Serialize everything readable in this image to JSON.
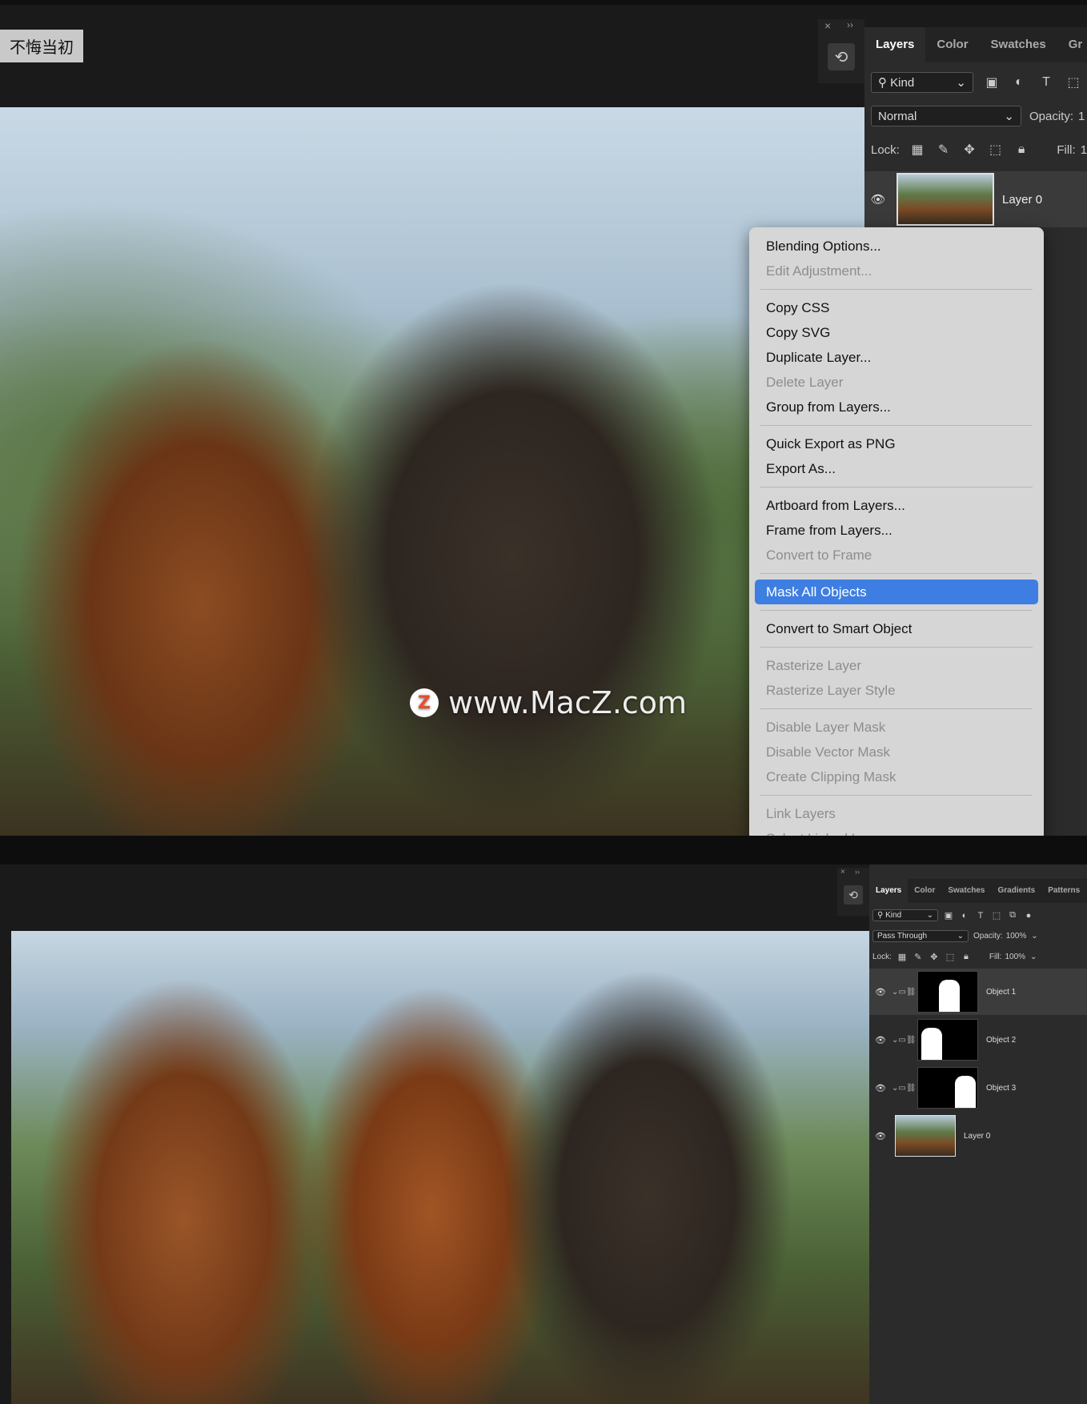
{
  "overlay_label": "不悔当初",
  "watermark": {
    "logo": "Z",
    "text": "www.MacZ.com"
  },
  "top_panel": {
    "close": "×",
    "collapse": "››",
    "tabs": [
      "Layers",
      "Color",
      "Swatches",
      "Gr"
    ],
    "kind_label": "Kind",
    "blend_mode": "Normal",
    "opacity_label": "Opacity:",
    "opacity_value": "1",
    "lock_label": "Lock:",
    "fill_label": "Fill:",
    "fill_value": "1",
    "layer_name": "Layer 0"
  },
  "context_menu": {
    "items": [
      {
        "label": "Blending Options...",
        "disabled": false
      },
      {
        "label": "Edit Adjustment...",
        "disabled": true
      },
      {
        "sep": true
      },
      {
        "label": "Copy CSS",
        "disabled": false
      },
      {
        "label": "Copy SVG",
        "disabled": false
      },
      {
        "label": "Duplicate Layer...",
        "disabled": false
      },
      {
        "label": "Delete Layer",
        "disabled": true
      },
      {
        "label": "Group from Layers...",
        "disabled": false
      },
      {
        "sep": true
      },
      {
        "label": "Quick Export as PNG",
        "disabled": false
      },
      {
        "label": "Export As...",
        "disabled": false
      },
      {
        "sep": true
      },
      {
        "label": "Artboard from Layers...",
        "disabled": false
      },
      {
        "label": "Frame from Layers...",
        "disabled": false
      },
      {
        "label": "Convert to Frame",
        "disabled": true
      },
      {
        "sep": true
      },
      {
        "label": "Mask All Objects",
        "disabled": false,
        "highlighted": true
      },
      {
        "sep": true
      },
      {
        "label": "Convert to Smart Object",
        "disabled": false
      },
      {
        "sep": true
      },
      {
        "label": "Rasterize Layer",
        "disabled": true
      },
      {
        "label": "Rasterize Layer Style",
        "disabled": true
      },
      {
        "sep": true
      },
      {
        "label": "Disable Layer Mask",
        "disabled": true
      },
      {
        "label": "Disable Vector Mask",
        "disabled": true
      },
      {
        "label": "Create Clipping Mask",
        "disabled": true
      },
      {
        "sep": true
      },
      {
        "label": "Link Layers",
        "disabled": true
      },
      {
        "label": "Select Linked Layers",
        "disabled": true
      }
    ]
  },
  "bottom_panel": {
    "tabs": [
      "Layers",
      "Color",
      "Swatches",
      "Gradients",
      "Patterns"
    ],
    "kind_label": "Kind",
    "blend_mode": "Pass Through",
    "opacity_label": "Opacity:",
    "opacity_value": "100%",
    "lock_label": "Lock:",
    "fill_label": "Fill:",
    "fill_value": "100%",
    "layers": [
      "Object 1",
      "Object 2",
      "Object 3",
      "Layer 0"
    ]
  }
}
